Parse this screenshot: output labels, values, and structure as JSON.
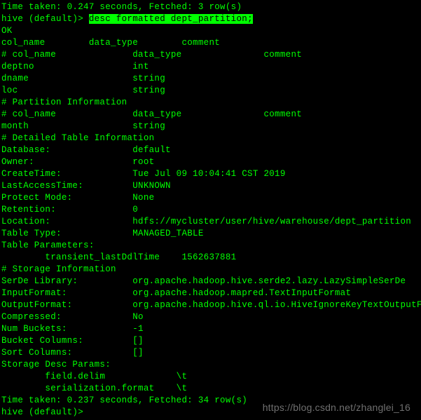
{
  "topline": "Time taken: 0.247 seconds, Fetched: 3 row(s)",
  "prompt1": "hive (default)> ",
  "highlighted_cmd": "desc formatted dept_partition;",
  "ok": "OK",
  "hdr1": "col_name        data_type        comment",
  "hdr2": "# col_name              data_type               comment              ",
  "blank": "",
  "columns": {
    "deptno": "deptno                  int                                          ",
    "dname": "dname                   string                                       ",
    "loc": "loc                     string                                       "
  },
  "partition_section_title": "# Partition Information          ",
  "partition_hdr": "# col_name              data_type               comment              ",
  "partition_row": "month                   string                                       ",
  "detailed_title": "# Detailed Table Information          ",
  "detailed": {
    "database": "Database:               default                   ",
    "owner": "Owner:                  root                      ",
    "createtime": "CreateTime:             Tue Jul 09 10:04:41 CST 2019      ",
    "lastaccess": "LastAccessTime:         UNKNOWN                   ",
    "protectmode": "Protect Mode:           None                      ",
    "retention": "Retention:              0                         ",
    "location": "Location:               hdfs://mycluster/user/hive/warehouse/dept_partition    ",
    "tabletype": "Table Type:             MANAGED_TABLE             ",
    "tableparams": "Table Parameters:          ",
    "transient": "        transient_lastDdlTime    1562637881           "
  },
  "storage_title": "# Storage Information          ",
  "storage": {
    "serde": "SerDe Library:          org.apache.hadoop.hive.serde2.lazy.LazySimpleSerDe      ",
    "inputfmt": "InputFormat:            org.apache.hadoop.mapred.TextInputFormat         ",
    "outputfmt": "OutputFormat:           org.apache.hadoop.hive.ql.io.HiveIgnoreKeyTextOutputFormat",
    "compressed": "Compressed:             No                        ",
    "numbuckets": "Num Buckets:            -1                        ",
    "bucketcols": "Bucket Columns:         []                        ",
    "sortcols": "Sort Columns:           []                        ",
    "descparams": "Storage Desc Params:          ",
    "fielddelim": "        field.delim             \\t                   ",
    "serformat": "        serialization.format    \\t                   "
  },
  "time_taken": "Time taken: 0.237 seconds, Fetched: 34 row(s)",
  "prompt2": "hive (default)> ",
  "watermark": "https://blog.csdn.net/zhanglei_16"
}
